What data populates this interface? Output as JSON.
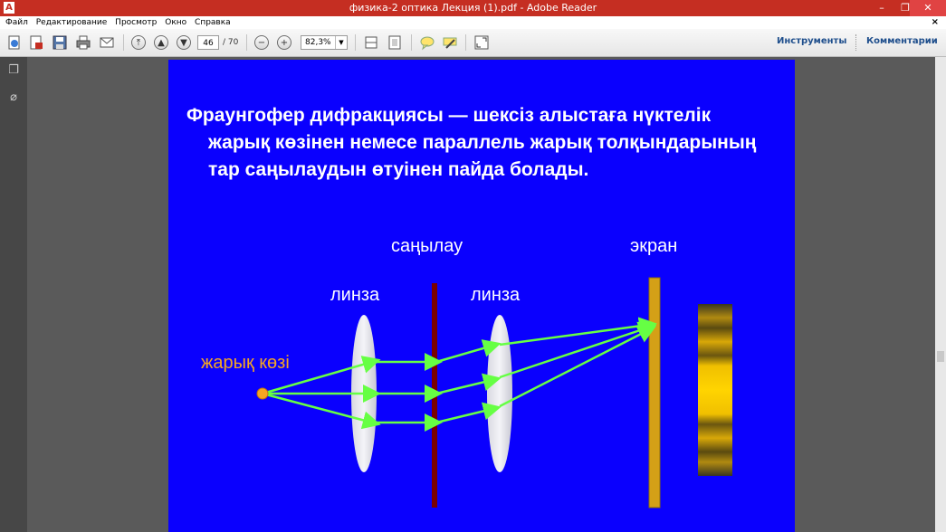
{
  "window": {
    "title": "физика-2 оптика Лекция (1).pdf - Adobe Reader",
    "app_icon": "adobe-reader-icon",
    "minimize": "–",
    "restore": "❐",
    "close": "✕"
  },
  "menu": {
    "items": [
      "Файл",
      "Редактирование",
      "Просмотр",
      "Окно",
      "Справка"
    ],
    "close_doc": "×"
  },
  "toolbar": {
    "page_current": "46",
    "page_total": "/ 70",
    "zoom": "82,3%",
    "tools_label": "Инструменты",
    "comments_label": "Комментарии"
  },
  "slide": {
    "heading_line1": "Фраунгофер дифракциясы  —  шексіз алыстаға нүктелік",
    "heading_line2": "жарық көзінен немесе параллель жарық толқындарының",
    "heading_line3": "тар саңылаудын өтуінен пайда болады.",
    "label_slit": "саңылау",
    "label_screen": "экран",
    "label_lens_left": "линза",
    "label_lens_right": "линза",
    "label_source": "жарық көзі",
    "colors": {
      "background": "#0a00fe",
      "rays": "#66ff44",
      "source": "#f5a623",
      "slit": "#7a0000",
      "screen": "#d4a017"
    }
  }
}
